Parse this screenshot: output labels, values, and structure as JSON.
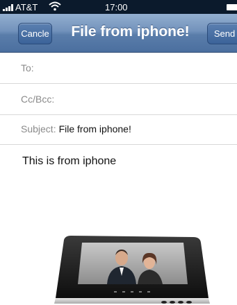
{
  "status_bar": {
    "carrier": "AT&T",
    "time": "17:00",
    "signal_icon": "signal-bars-icon",
    "wifi_icon": "wifi-icon",
    "battery_icon": "battery-icon"
  },
  "nav": {
    "cancel_label": "Cancle",
    "title": "File from iphone!",
    "send_label": "Send"
  },
  "fields": {
    "to_label": "To:",
    "to_value": "",
    "cc_label": "Cc/Bcc:",
    "cc_value": "",
    "subject_label": "Subject:",
    "subject_value": "File from iphone!"
  },
  "body": {
    "text": "This is from iphone"
  },
  "attachment": {
    "kind": "photo-frame-image",
    "accent": "#1a1a1a"
  },
  "colors": {
    "nav_top": "#93afd0",
    "nav_bottom": "#4b6f9f",
    "status_bar": "#0b1a2c"
  }
}
